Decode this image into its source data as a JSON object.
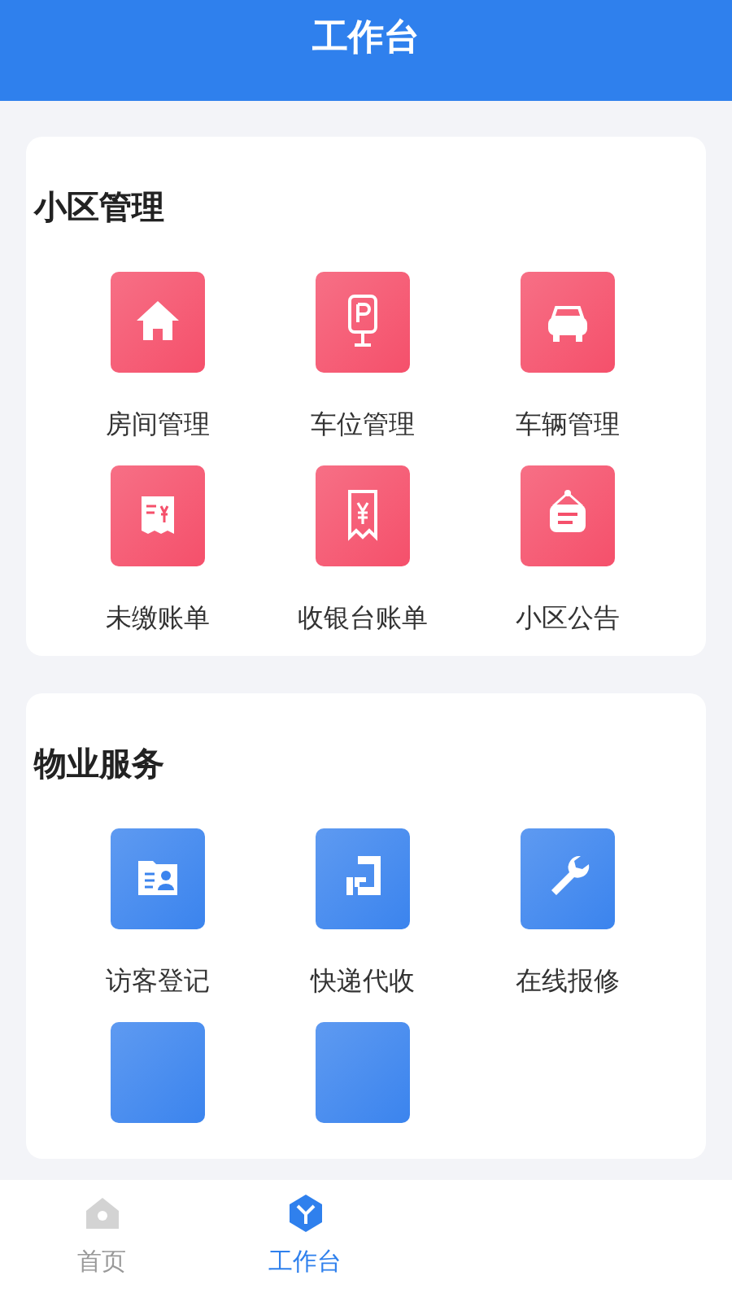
{
  "header": {
    "title": "工作台"
  },
  "sections": [
    {
      "title": "小区管理",
      "color": "#f5506b",
      "items": [
        {
          "kind": "full",
          "label": "房间管理"
        },
        {
          "kind": "full",
          "label": "车位管理"
        },
        {
          "kind": "full",
          "label": "车辆管理"
        },
        {
          "kind": "full",
          "label": "未缴账单"
        },
        {
          "kind": "full",
          "label": "收银台账单"
        },
        {
          "kind": "full",
          "label": "小区公告"
        }
      ]
    },
    {
      "title": "物业服务",
      "color": "#3b84ee",
      "items": [
        {
          "kind": "full",
          "label": "访客登记"
        },
        {
          "kind": "full",
          "label": "快递代收"
        },
        {
          "kind": "full",
          "label": "在线报修"
        },
        {
          "kind": "partial"
        },
        {
          "kind": "partial"
        }
      ]
    }
  ],
  "tabs": [
    {
      "label": "首页",
      "selected": false
    },
    {
      "label": "工作台",
      "selected": true
    }
  ]
}
